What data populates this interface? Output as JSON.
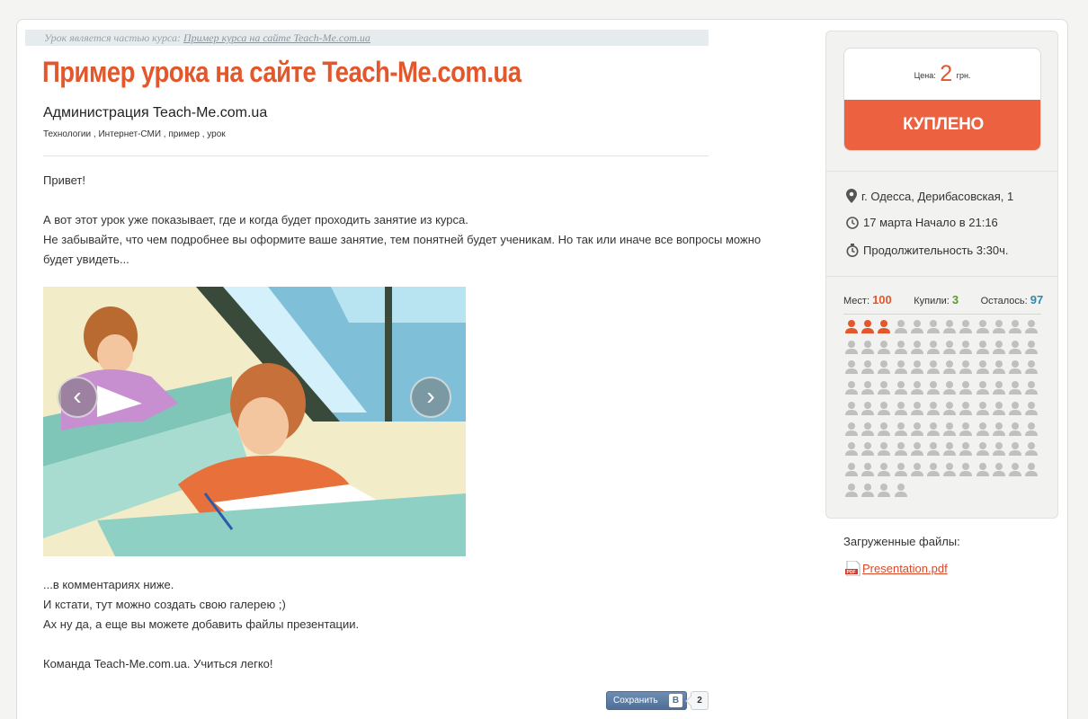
{
  "breadcrumb": {
    "prefix": "Урок является частью курса:",
    "link": "Пример курса на сайте Teach-Me.com.ua"
  },
  "lesson": {
    "title": "Пример урока на сайте Teach-Me.com.ua",
    "author": "Администрация Teach-Me.com.ua",
    "tags": [
      "Технологии",
      "Интернет-СМИ",
      "пример",
      "урок"
    ]
  },
  "content": {
    "p1": "Привет!",
    "p2_line1": "А вот этот урок уже показывает, где и когда будет проходить занятие из курса.",
    "p2_line2": "Не забывайте, что чем подробнее вы оформите ваше занятие, тем понятней будет ученикам. Но так или иначе все вопросы можно",
    "p2_line3": "будет увидеть...",
    "p3_line1": "...в комментариях ниже.",
    "p3_line2": "И кстати, тут можно создать свою галерею ;)",
    "p3_line3": "Ах ну да, а еще вы можете добавить файлы презентации.",
    "p4": "Команда Teach-Me.com.ua. Учиться легко!"
  },
  "gallery": {
    "prev_icon": "chevron-left-icon",
    "next_icon": "chevron-right-icon",
    "prev_glyph": "‹",
    "next_glyph": "›"
  },
  "social": {
    "save_label": "Сохранить",
    "vk_logo": "B",
    "count": "2"
  },
  "purchase": {
    "price_label": "Цена:",
    "price_value": "2",
    "price_currency": "грн.",
    "button_label": "КУПЛЕНО"
  },
  "event": {
    "location": "г. Одесса, Дерибасовская, 1",
    "datetime": "17 марта Начало в 21:16",
    "duration": "Продолжительность 3:30ч."
  },
  "seats": {
    "total_label": "Мест:",
    "total": "100",
    "bought_label": "Купили:",
    "bought": "3",
    "left_label": "Осталось:",
    "left": "97",
    "count_total": 100,
    "count_taken": 3
  },
  "files": {
    "title": "Загруженные файлы:",
    "items": [
      {
        "name": "Presentation.pdf",
        "icon": "pdf-icon"
      }
    ]
  },
  "colors": {
    "accent": "#e2572c",
    "button": "#ec6140",
    "bought": "#5a9a2a",
    "left": "#2b8ab5",
    "seat_free": "#c0c0c0"
  }
}
